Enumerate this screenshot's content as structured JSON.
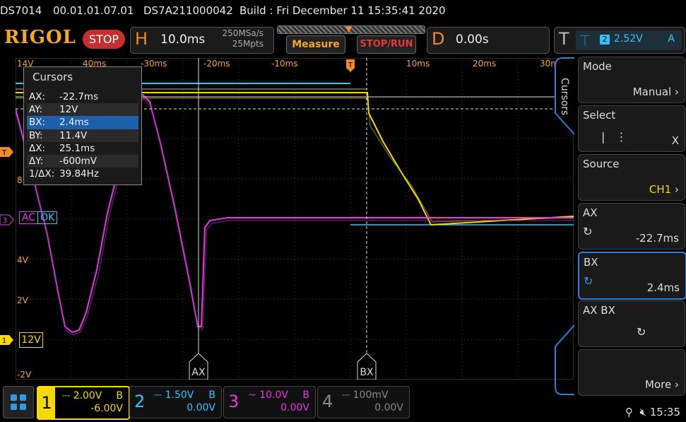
{
  "info_line": {
    "model": "DS7014",
    "version": "00.01.01.07.01",
    "serial": "DS7A211000042",
    "build": "Build : Fri December 11 15:35:41 2020"
  },
  "header": {
    "logo": "RIGOL",
    "run_state": "STOP",
    "horizontal": {
      "letter": "H",
      "timebase": "10.0ms",
      "sample_rate": "250MSa/s",
      "memory_depth": "25Mpts"
    },
    "measure_label": "Measure",
    "stoprun_label": "STOP/RUN",
    "delay": {
      "letter": "D",
      "value": "0.00s"
    },
    "trigger": {
      "letter": "T",
      "source": "2",
      "level": "2.52V",
      "mode": "A"
    }
  },
  "time_axis_labels": [
    "40ms",
    "-30ms",
    "-20ms",
    "-10ms",
    "10ms",
    "20ms",
    "30ms"
  ],
  "volt_axis_labels": [
    "14V",
    "8",
    "4V",
    "2V",
    "-2V"
  ],
  "left_markers": {
    "trigger": "T",
    "ch3": "3",
    "ch1": "1"
  },
  "cursor_panel": {
    "title": "Cursors",
    "rows": [
      {
        "key": "AX:",
        "value": "-22.7ms"
      },
      {
        "key": "AY:",
        "value": "12V"
      },
      {
        "key": "BX:",
        "value": "2.4ms"
      },
      {
        "key": "BY:",
        "value": "11.4V"
      },
      {
        "key": "ΔX:",
        "value": "25.1ms"
      },
      {
        "key": "ΔY:",
        "value": "-600mV"
      },
      {
        "key": "1/ΔX:",
        "value": "39.84Hz"
      }
    ],
    "selected_row": 2
  },
  "badges": {
    "ac": "AC",
    "ok": "OK",
    "ch1_level": "12V"
  },
  "cursor_labels": {
    "a": "AX",
    "b": "BX"
  },
  "menu": {
    "tab_title": "Cursors",
    "items": [
      {
        "label": "Mode",
        "value": "Manual"
      },
      {
        "label": "Select",
        "value": "X"
      },
      {
        "label": "Source",
        "value": "CH1"
      },
      {
        "label": "AX",
        "value": "-22.7ms"
      },
      {
        "label": "BX",
        "value": "2.4ms"
      },
      {
        "label": "AX BX",
        "value": ""
      },
      {
        "label": "",
        "value": "More"
      }
    ]
  },
  "channels": [
    {
      "num": "1",
      "scale": "2.00V",
      "bw": "B",
      "offset": "-6.00V",
      "coupling": "DC",
      "color": "#f5d800"
    },
    {
      "num": "2",
      "scale": "1.50V",
      "bw": "B",
      "offset": "0.00V",
      "coupling": "DC",
      "color": "#2ec5ff"
    },
    {
      "num": "3",
      "scale": "10.0V",
      "bw": "B",
      "offset": "0.00V",
      "coupling": "AC",
      "color": "#e23be2"
    },
    {
      "num": "4",
      "scale": "100mV",
      "bw": "",
      "offset": "0.00V",
      "coupling": "DC",
      "color": "#888888"
    }
  ],
  "status": {
    "time": "15:35"
  }
}
